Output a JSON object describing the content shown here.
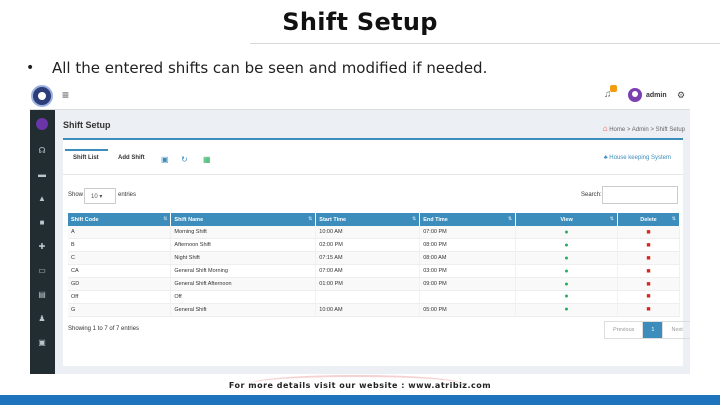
{
  "slide": {
    "title": "Shift Setup",
    "bullet_text": "All the entered shifts can be seen and modified if needed.",
    "footer": "For more details visit our website : www.atribiz.com"
  },
  "app": {
    "topbar": {
      "user": "admin",
      "notification_count": "0"
    },
    "page_title": "Shift Setup",
    "breadcrumb": {
      "home": "Home",
      "sep1": ">",
      "admin": "Admin",
      "sep2": ">",
      "current": "Shift Setup"
    },
    "tabs": [
      {
        "label": "Shift List"
      },
      {
        "label": "Add Shift"
      }
    ],
    "housekeeping_link": "House keeping System",
    "show_label": "Show",
    "show_value": "10",
    "entries_label": "entries",
    "search_label": "Search:",
    "columns": [
      "Shift Code",
      "Shift Name",
      "Start Time",
      "End Time",
      "View",
      "Delete"
    ],
    "rows": [
      {
        "code": "A",
        "name": "Morning Shift",
        "start": "10:00 AM",
        "end": "07:00 PM"
      },
      {
        "code": "B",
        "name": "Afternoon Shift",
        "start": "02:00 PM",
        "end": "08:00 PM"
      },
      {
        "code": "C",
        "name": "Night Shift",
        "start": "07:15 AM",
        "end": "08:00 AM"
      },
      {
        "code": "CA",
        "name": "General Shift Morning",
        "start": "07:00 AM",
        "end": "03:00 PM"
      },
      {
        "code": "GD",
        "name": "General Shift Afternoon",
        "start": "01:00 PM",
        "end": "09:00 PM"
      },
      {
        "code": "Off",
        "name": "Off",
        "start": "",
        "end": ""
      },
      {
        "code": "G",
        "name": "General Shift",
        "start": "10:00 AM",
        "end": "05:00 PM"
      }
    ],
    "info": "Showing 1 to 7 of 7 entries",
    "pager": {
      "previous": "Previous",
      "page": "1",
      "next": "Next"
    }
  },
  "colors": {
    "primary": "#3c8dbc",
    "sidebar": "#222d32",
    "view": "#27ae60",
    "delete": "#d9261c",
    "footer_bar": "#1f75bd"
  }
}
